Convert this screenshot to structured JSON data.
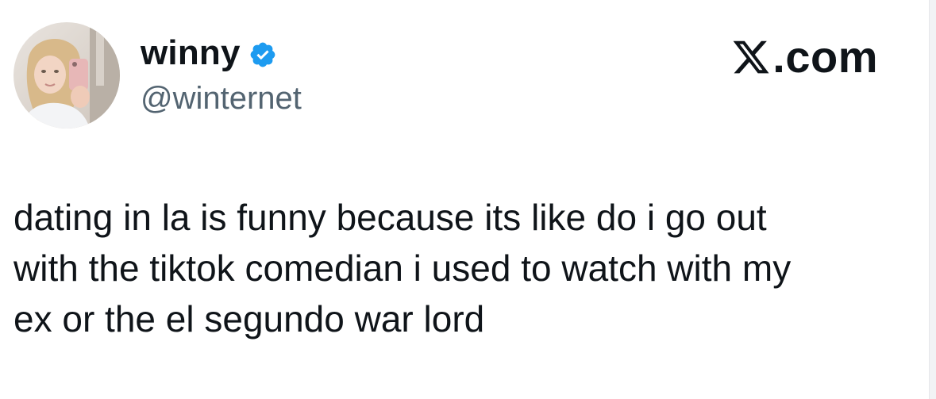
{
  "tweet": {
    "author": {
      "display_name": "winny",
      "handle": "@winternet",
      "verified": true,
      "avatar": "profile-photo-selfie"
    },
    "brand": {
      "label": ".com",
      "icon": "x-logo-icon"
    },
    "text": "dating in la is funny because its like do i go out\nwith the tiktok comedian i used to watch with my\nex or the el segundo war lord"
  },
  "colors": {
    "text": "#0f1419",
    "handle": "#536471",
    "verified": "#1d9bf0",
    "background": "#ffffff"
  }
}
